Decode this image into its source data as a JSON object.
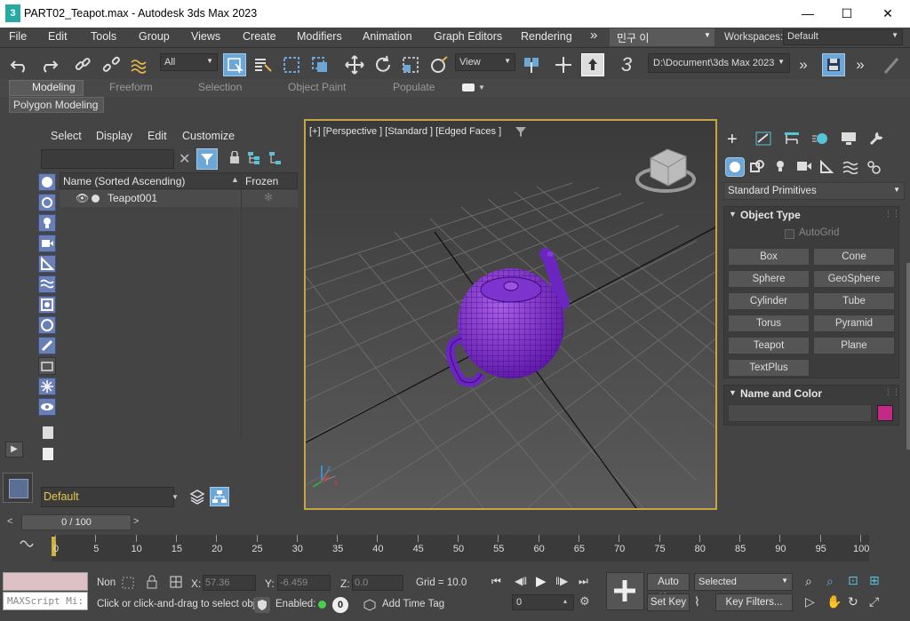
{
  "window": {
    "title": "PART02_Teapot.max - Autodesk 3ds Max 2023",
    "app_icon_label": "3",
    "minimize": "—",
    "maximize": "☐",
    "close": "✕"
  },
  "menu": [
    "File",
    "Edit",
    "Tools",
    "Group",
    "Views",
    "Create",
    "Modifiers",
    "Animation",
    "Graph Editors",
    "Rendering"
  ],
  "menu_more": "»",
  "user": "민구 이",
  "workspaces": {
    "label": "Workspaces:",
    "value": "Default"
  },
  "toolbar": {
    "filter": "All",
    "view": "View",
    "path": "D:\\Document\\3ds Max 2023",
    "three": "3"
  },
  "ribbon": {
    "tabs": [
      "Modeling",
      "Freeform",
      "Selection",
      "Object Paint",
      "Populate"
    ],
    "active": "Modeling",
    "sub": "Polygon Modeling"
  },
  "explorer": {
    "menu": [
      "Select",
      "Display",
      "Edit",
      "Customize"
    ],
    "col_name": "Name (Sorted Ascending)",
    "col_frozen": "Frozen",
    "rows": [
      {
        "name": "Teapot001"
      }
    ],
    "layer": "Default"
  },
  "viewport": {
    "label": "[+] [Perspective ] [Standard ] [Edged Faces ]",
    "axis_z": "z",
    "axis_x": "x"
  },
  "command": {
    "category": "Standard Primitives",
    "object_type": "Object Type",
    "autogrid": "AutoGrid",
    "buttons": [
      "Box",
      "Cone",
      "Sphere",
      "GeoSphere",
      "Cylinder",
      "Tube",
      "Torus",
      "Pyramid",
      "Teapot",
      "Plane",
      "TextPlus"
    ],
    "name_color": "Name and Color",
    "swatch": "#c22a86"
  },
  "timeline": {
    "counter": "0 / 100",
    "ticks": [
      "0",
      "5",
      "10",
      "15",
      "20",
      "25",
      "30",
      "35",
      "40",
      "45",
      "50",
      "55",
      "60",
      "65",
      "70",
      "75",
      "80",
      "85",
      "90",
      "95",
      "100"
    ]
  },
  "status": {
    "maxscript": "MAXScript Mi:",
    "none": "Non",
    "prompt": "Click or click-and-drag to select obj",
    "x_label": "X:",
    "x": "57.36",
    "y_label": "Y:",
    "y": "-6.459",
    "z_label": "Z:",
    "z": "0.0",
    "grid": "Grid = 10.0",
    "enabled": "Enabled:",
    "add_time_tag": "Add Time Tag",
    "frame": "0",
    "auto_key": "Auto Key",
    "set_key": "Set Key",
    "selected": "Selected",
    "key_filters": "Key Filters...",
    "zero": "0"
  }
}
